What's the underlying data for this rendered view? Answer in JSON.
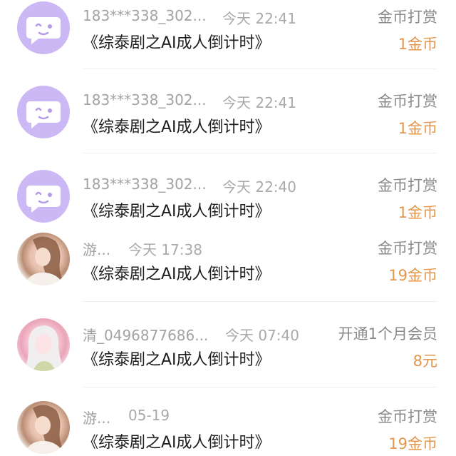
{
  "items": [
    {
      "name": "183***338_302...",
      "time": "今天 22:41",
      "title": "《综泰剧之AI成人倒计时》",
      "type": "金币打赏",
      "amount": "1金币"
    },
    {
      "name": "183***338_302...",
      "time": "今天 22:41",
      "title": "《综泰剧之AI成人倒计时》",
      "type": "金币打赏",
      "amount": "1金币"
    },
    {
      "name": "183***338_302...",
      "time": "今天 22:40",
      "title": "《综泰剧之AI成人倒计时》",
      "type": "金币打赏",
      "amount": "1金币"
    },
    {
      "name": "游...",
      "time": "今天 17:38",
      "title": "《综泰剧之AI成人倒计时》",
      "type": "金币打赏",
      "amount": "19金币"
    },
    {
      "name": "清_0496877686...",
      "time": "今天 07:40",
      "title": "《综泰剧之AI成人倒计时》",
      "type": "开通1个月会员",
      "amount": "8元"
    },
    {
      "name": "游...",
      "time": "05-19",
      "title": "《综泰剧之AI成人倒计时》",
      "type": "金币打赏",
      "amount": "19金币"
    }
  ],
  "colors": {
    "amount": "#e3964c",
    "robot_avatar": "#cdb8f6"
  },
  "icons": {
    "robot_avatar": "chat-bubble-face-icon"
  }
}
